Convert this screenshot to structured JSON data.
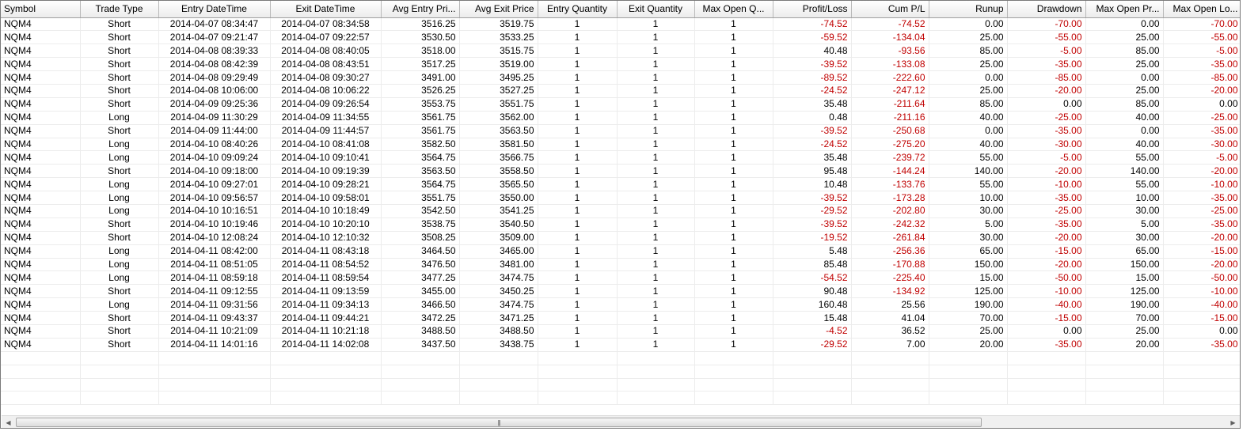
{
  "columns": [
    {
      "key": "symbol",
      "label": "Symbol",
      "width": 100,
      "align": "l"
    },
    {
      "key": "type",
      "label": "Trade Type",
      "width": 99,
      "align": "c"
    },
    {
      "key": "entry_dt",
      "label": "Entry DateTime",
      "width": 141,
      "align": "c"
    },
    {
      "key": "exit_dt",
      "label": "Exit DateTime",
      "width": 140,
      "align": "c"
    },
    {
      "key": "avg_entry",
      "label": "Avg Entry Pri...",
      "width": 99,
      "align": "r"
    },
    {
      "key": "avg_exit",
      "label": "Avg Exit Price",
      "width": 99,
      "align": "r"
    },
    {
      "key": "entry_qty",
      "label": "Entry Quantity",
      "width": 100,
      "align": "c"
    },
    {
      "key": "exit_qty",
      "label": "Exit Quantity",
      "width": 98,
      "align": "c"
    },
    {
      "key": "max_qty",
      "label": "Max Open Q...",
      "width": 99,
      "align": "c"
    },
    {
      "key": "pl",
      "label": "Profit/Loss",
      "width": 99,
      "align": "r"
    },
    {
      "key": "cum_pl",
      "label": "Cum P/L",
      "width": 98,
      "align": "r"
    },
    {
      "key": "runup",
      "label": "Runup",
      "width": 99,
      "align": "r"
    },
    {
      "key": "drawdown",
      "label": "Drawdown",
      "width": 99,
      "align": "r"
    },
    {
      "key": "max_open_pr",
      "label": "Max Open Pr...",
      "width": 98,
      "align": "r"
    },
    {
      "key": "max_open_lo",
      "label": "Max Open Lo...",
      "width": 99,
      "align": "r"
    }
  ],
  "rows": [
    [
      "NQM4",
      "Short",
      "2014-04-07 08:34:47",
      "2014-04-07 08:34:58",
      "3516.25",
      "3519.75",
      "1",
      "1",
      "1",
      "-74.52",
      "-74.52",
      "0.00",
      "-70.00",
      "0.00",
      "-70.00"
    ],
    [
      "NQM4",
      "Short",
      "2014-04-07 09:21:47",
      "2014-04-07 09:22:57",
      "3530.50",
      "3533.25",
      "1",
      "1",
      "1",
      "-59.52",
      "-134.04",
      "25.00",
      "-55.00",
      "25.00",
      "-55.00"
    ],
    [
      "NQM4",
      "Short",
      "2014-04-08 08:39:33",
      "2014-04-08 08:40:05",
      "3518.00",
      "3515.75",
      "1",
      "1",
      "1",
      "40.48",
      "-93.56",
      "85.00",
      "-5.00",
      "85.00",
      "-5.00"
    ],
    [
      "NQM4",
      "Short",
      "2014-04-08 08:42:39",
      "2014-04-08 08:43:51",
      "3517.25",
      "3519.00",
      "1",
      "1",
      "1",
      "-39.52",
      "-133.08",
      "25.00",
      "-35.00",
      "25.00",
      "-35.00"
    ],
    [
      "NQM4",
      "Short",
      "2014-04-08 09:29:49",
      "2014-04-08 09:30:27",
      "3491.00",
      "3495.25",
      "1",
      "1",
      "1",
      "-89.52",
      "-222.60",
      "0.00",
      "-85.00",
      "0.00",
      "-85.00"
    ],
    [
      "NQM4",
      "Short",
      "2014-04-08 10:06:00",
      "2014-04-08 10:06:22",
      "3526.25",
      "3527.25",
      "1",
      "1",
      "1",
      "-24.52",
      "-247.12",
      "25.00",
      "-20.00",
      "25.00",
      "-20.00"
    ],
    [
      "NQM4",
      "Short",
      "2014-04-09 09:25:36",
      "2014-04-09 09:26:54",
      "3553.75",
      "3551.75",
      "1",
      "1",
      "1",
      "35.48",
      "-211.64",
      "85.00",
      "0.00",
      "85.00",
      "0.00"
    ],
    [
      "NQM4",
      "Long",
      "2014-04-09 11:30:29",
      "2014-04-09 11:34:55",
      "3561.75",
      "3562.00",
      "1",
      "1",
      "1",
      "0.48",
      "-211.16",
      "40.00",
      "-25.00",
      "40.00",
      "-25.00"
    ],
    [
      "NQM4",
      "Short",
      "2014-04-09 11:44:00",
      "2014-04-09 11:44:57",
      "3561.75",
      "3563.50",
      "1",
      "1",
      "1",
      "-39.52",
      "-250.68",
      "0.00",
      "-35.00",
      "0.00",
      "-35.00"
    ],
    [
      "NQM4",
      "Long",
      "2014-04-10 08:40:26",
      "2014-04-10 08:41:08",
      "3582.50",
      "3581.50",
      "1",
      "1",
      "1",
      "-24.52",
      "-275.20",
      "40.00",
      "-30.00",
      "40.00",
      "-30.00"
    ],
    [
      "NQM4",
      "Long",
      "2014-04-10 09:09:24",
      "2014-04-10 09:10:41",
      "3564.75",
      "3566.75",
      "1",
      "1",
      "1",
      "35.48",
      "-239.72",
      "55.00",
      "-5.00",
      "55.00",
      "-5.00"
    ],
    [
      "NQM4",
      "Short",
      "2014-04-10 09:18:00",
      "2014-04-10 09:19:39",
      "3563.50",
      "3558.50",
      "1",
      "1",
      "1",
      "95.48",
      "-144.24",
      "140.00",
      "-20.00",
      "140.00",
      "-20.00"
    ],
    [
      "NQM4",
      "Long",
      "2014-04-10 09:27:01",
      "2014-04-10 09:28:21",
      "3564.75",
      "3565.50",
      "1",
      "1",
      "1",
      "10.48",
      "-133.76",
      "55.00",
      "-10.00",
      "55.00",
      "-10.00"
    ],
    [
      "NQM4",
      "Long",
      "2014-04-10 09:56:57",
      "2014-04-10 09:58:01",
      "3551.75",
      "3550.00",
      "1",
      "1",
      "1",
      "-39.52",
      "-173.28",
      "10.00",
      "-35.00",
      "10.00",
      "-35.00"
    ],
    [
      "NQM4",
      "Long",
      "2014-04-10 10:16:51",
      "2014-04-10 10:18:49",
      "3542.50",
      "3541.25",
      "1",
      "1",
      "1",
      "-29.52",
      "-202.80",
      "30.00",
      "-25.00",
      "30.00",
      "-25.00"
    ],
    [
      "NQM4",
      "Short",
      "2014-04-10 10:19:46",
      "2014-04-10 10:20:10",
      "3538.75",
      "3540.50",
      "1",
      "1",
      "1",
      "-39.52",
      "-242.32",
      "5.00",
      "-35.00",
      "5.00",
      "-35.00"
    ],
    [
      "NQM4",
      "Short",
      "2014-04-10 12:08:24",
      "2014-04-10 12:10:32",
      "3508.25",
      "3509.00",
      "1",
      "1",
      "1",
      "-19.52",
      "-261.84",
      "30.00",
      "-20.00",
      "30.00",
      "-20.00"
    ],
    [
      "NQM4",
      "Long",
      "2014-04-11 08:42:00",
      "2014-04-11 08:43:18",
      "3464.50",
      "3465.00",
      "1",
      "1",
      "1",
      "5.48",
      "-256.36",
      "65.00",
      "-15.00",
      "65.00",
      "-15.00"
    ],
    [
      "NQM4",
      "Long",
      "2014-04-11 08:51:05",
      "2014-04-11 08:54:52",
      "3476.50",
      "3481.00",
      "1",
      "1",
      "1",
      "85.48",
      "-170.88",
      "150.00",
      "-20.00",
      "150.00",
      "-20.00"
    ],
    [
      "NQM4",
      "Long",
      "2014-04-11 08:59:18",
      "2014-04-11 08:59:54",
      "3477.25",
      "3474.75",
      "1",
      "1",
      "1",
      "-54.52",
      "-225.40",
      "15.00",
      "-50.00",
      "15.00",
      "-50.00"
    ],
    [
      "NQM4",
      "Short",
      "2014-04-11 09:12:55",
      "2014-04-11 09:13:59",
      "3455.00",
      "3450.25",
      "1",
      "1",
      "1",
      "90.48",
      "-134.92",
      "125.00",
      "-10.00",
      "125.00",
      "-10.00"
    ],
    [
      "NQM4",
      "Long",
      "2014-04-11 09:31:56",
      "2014-04-11 09:34:13",
      "3466.50",
      "3474.75",
      "1",
      "1",
      "1",
      "160.48",
      "25.56",
      "190.00",
      "-40.00",
      "190.00",
      "-40.00"
    ],
    [
      "NQM4",
      "Short",
      "2014-04-11 09:43:37",
      "2014-04-11 09:44:21",
      "3472.25",
      "3471.25",
      "1",
      "1",
      "1",
      "15.48",
      "41.04",
      "70.00",
      "-15.00",
      "70.00",
      "-15.00"
    ],
    [
      "NQM4",
      "Short",
      "2014-04-11 10:21:09",
      "2014-04-11 10:21:18",
      "3488.50",
      "3488.50",
      "1",
      "1",
      "1",
      "-4.52",
      "36.52",
      "25.00",
      "0.00",
      "25.00",
      "0.00"
    ],
    [
      "NQM4",
      "Short",
      "2014-04-11 14:01:16",
      "2014-04-11 14:02:08",
      "3437.50",
      "3438.75",
      "1",
      "1",
      "1",
      "-29.52",
      "7.00",
      "20.00",
      "-35.00",
      "20.00",
      "-35.00"
    ]
  ],
  "empty_rows": 4,
  "colors": {
    "negative": "#c00000",
    "positive": "#000000"
  },
  "scrollbar": {
    "left_icon": "arrow-left-icon",
    "right_icon": "arrow-right-icon",
    "grip_icon": "grip-icon"
  }
}
